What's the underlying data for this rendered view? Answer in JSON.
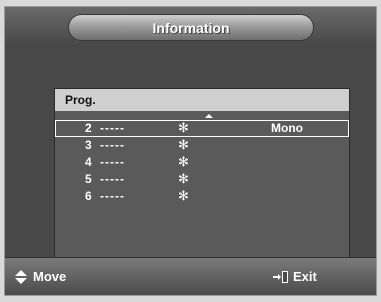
{
  "title": "Information",
  "panel": {
    "header": "Prog.",
    "rows": [
      {
        "num": "2",
        "name": "-----",
        "star": "✻",
        "sound": "Mono",
        "selected": true
      },
      {
        "num": "3",
        "name": "-----",
        "star": "✻",
        "sound": ""
      },
      {
        "num": "4",
        "name": "-----",
        "star": "✻",
        "sound": ""
      },
      {
        "num": "5",
        "name": "-----",
        "star": "✻",
        "sound": ""
      },
      {
        "num": "6",
        "name": "-----",
        "star": "✻",
        "sound": ""
      }
    ]
  },
  "footer": {
    "move_label": "Move",
    "exit_label": "Exit"
  },
  "icons": {
    "move": "up-down-arrows-icon",
    "exit": "exit-door-icon",
    "scroll_up": "scroll-up-icon",
    "scroll_down": "scroll-down-icon"
  },
  "colors": {
    "background": "#484848",
    "panel_header": "#cfcfcf",
    "text": "#ffffff"
  }
}
